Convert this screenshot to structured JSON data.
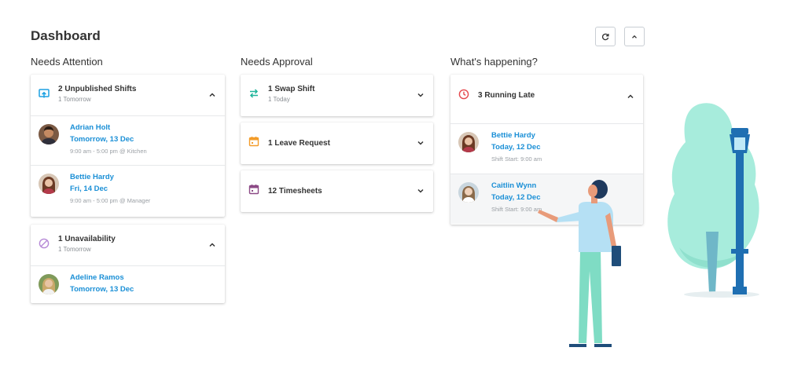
{
  "page_title": "Dashboard",
  "toolbar": {
    "refresh_icon": "refresh-icon",
    "collapse_icon": "chevron-up-icon"
  },
  "colors": {
    "accent": "#1a8fd6",
    "unpublished": "#1da1e2",
    "swap": "#1fb59a",
    "leave": "#f39c2a",
    "timesheet": "#8c4a86",
    "unavailability": "#b689d6",
    "late": "#e5484d"
  },
  "columns": {
    "attention": {
      "heading": "Needs Attention",
      "unpublished": {
        "title": "2 Unpublished Shifts",
        "subtitle": "1 Tomorrow",
        "icon": "upload-screen-icon",
        "people": [
          {
            "name": "Adrian Holt",
            "date": "Tomorrow, 13 Dec",
            "meta": "9:00 am - 5:00 pm @ Kitchen"
          },
          {
            "name": "Bettie Hardy",
            "date": "Fri, 14 Dec",
            "meta": "9:00 am - 5:00 pm @ Manager"
          }
        ]
      },
      "unavailability": {
        "title": "1 Unavailability",
        "subtitle": "1 Tomorrow",
        "icon": "ban-icon",
        "people": [
          {
            "name": "Adeline Ramos",
            "date": "Tomorrow, 13 Dec"
          }
        ]
      }
    },
    "approval": {
      "heading": "Needs Approval",
      "swap": {
        "title": "1 Swap Shift",
        "subtitle": "1 Today",
        "icon": "swap-arrows-icon"
      },
      "leave": {
        "title": "1 Leave Request",
        "icon": "calendar-icon"
      },
      "timesheets": {
        "title": "12 Timesheets",
        "icon": "calendar-icon"
      }
    },
    "happening": {
      "heading": "What's happening?",
      "late": {
        "title": "3 Running Late",
        "icon": "clock-icon",
        "people": [
          {
            "name": "Bettie Hardy",
            "date": "Today, 12 Dec",
            "meta": "Shift Start: 9:00 am"
          },
          {
            "name": "Caitlin Wynn",
            "date": "Today, 12 Dec",
            "meta": "Shift Start: 9:00 am"
          }
        ]
      }
    }
  }
}
